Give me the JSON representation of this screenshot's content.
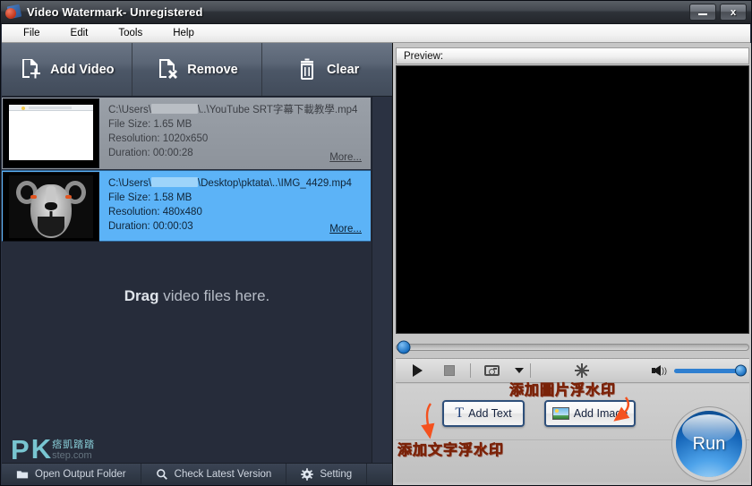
{
  "window": {
    "title": "Video Watermark- Unregistered",
    "icon": "app-icon",
    "minimize_label": "minimize",
    "close_label": "x"
  },
  "menubar": {
    "items": [
      {
        "label": "File"
      },
      {
        "label": "Edit"
      },
      {
        "label": "Tools"
      },
      {
        "label": "Help"
      }
    ]
  },
  "toolbar": {
    "buttons": [
      {
        "label": "Add Video",
        "icon": "add-video-icon"
      },
      {
        "label": "Remove",
        "icon": "remove-video-icon"
      },
      {
        "label": "Clear",
        "icon": "trash-icon"
      }
    ]
  },
  "file_list": {
    "drag_hint_bold": "Drag",
    "drag_hint_rest": " video files here.",
    "items": [
      {
        "path_prefix": "C:\\Users\\",
        "path_suffix": "\\..\\YouTube SRT字幕下載教學.mp4",
        "file_size": "File Size: 1.65 MB",
        "resolution": "Resolution: 1020x650",
        "duration": "Duration: 00:00:28",
        "more": "More...",
        "selected": false,
        "thumb": "browser-thumbnail"
      },
      {
        "path_prefix": "C:\\Users\\",
        "path_suffix": "\\Desktop\\pktata\\..\\IMG_4429.mp4",
        "file_size": "File Size: 1.58 MB",
        "resolution": "Resolution: 480x480",
        "duration": "Duration: 00:00:03",
        "more": "More...",
        "selected": true,
        "thumb": "panda-thumbnail"
      }
    ]
  },
  "watermark_logo": {
    "pk_left": "P",
    "pk_right": "K",
    "cn": "痞凱踏踏",
    "domain": "step.com"
  },
  "statusbar": {
    "buttons": [
      {
        "label": "Open Output Folder",
        "icon": "folder-icon"
      },
      {
        "label": "Check Latest Version",
        "icon": "search-icon"
      },
      {
        "label": "Setting",
        "icon": "gear-icon"
      }
    ]
  },
  "preview": {
    "header_label": "Preview:",
    "seek_value": 0,
    "volume_value": 100,
    "controls": [
      {
        "name": "play-button",
        "icon": "play-icon"
      },
      {
        "name": "stop-button",
        "icon": "stop-icon"
      },
      {
        "name": "snapshot-button",
        "icon": "camera-icon"
      },
      {
        "name": "snapshot-dropdown",
        "icon": "chevron-down-icon"
      },
      {
        "name": "effects-button",
        "icon": "sparkle-icon"
      },
      {
        "name": "volume-button",
        "icon": "speaker-icon"
      }
    ]
  },
  "watermark_tools": {
    "add_text_label": "Add Text",
    "add_text_icon": "text-t-icon",
    "add_image_label": "Add Image",
    "add_image_icon": "picture-icon",
    "run_label": "Run"
  },
  "annotations": [
    {
      "id": "add-image-annotation",
      "text": "添加圖片浮水印",
      "color": "#f4511e"
    },
    {
      "id": "add-text-annotation",
      "text": "添加文字浮水印",
      "color": "#f4511e"
    }
  ],
  "colors": {
    "accent_blue": "#5cb3f7",
    "panel_dark": "#262c3a",
    "titlebar": "#3a3f46",
    "annotation": "#f4511e"
  }
}
